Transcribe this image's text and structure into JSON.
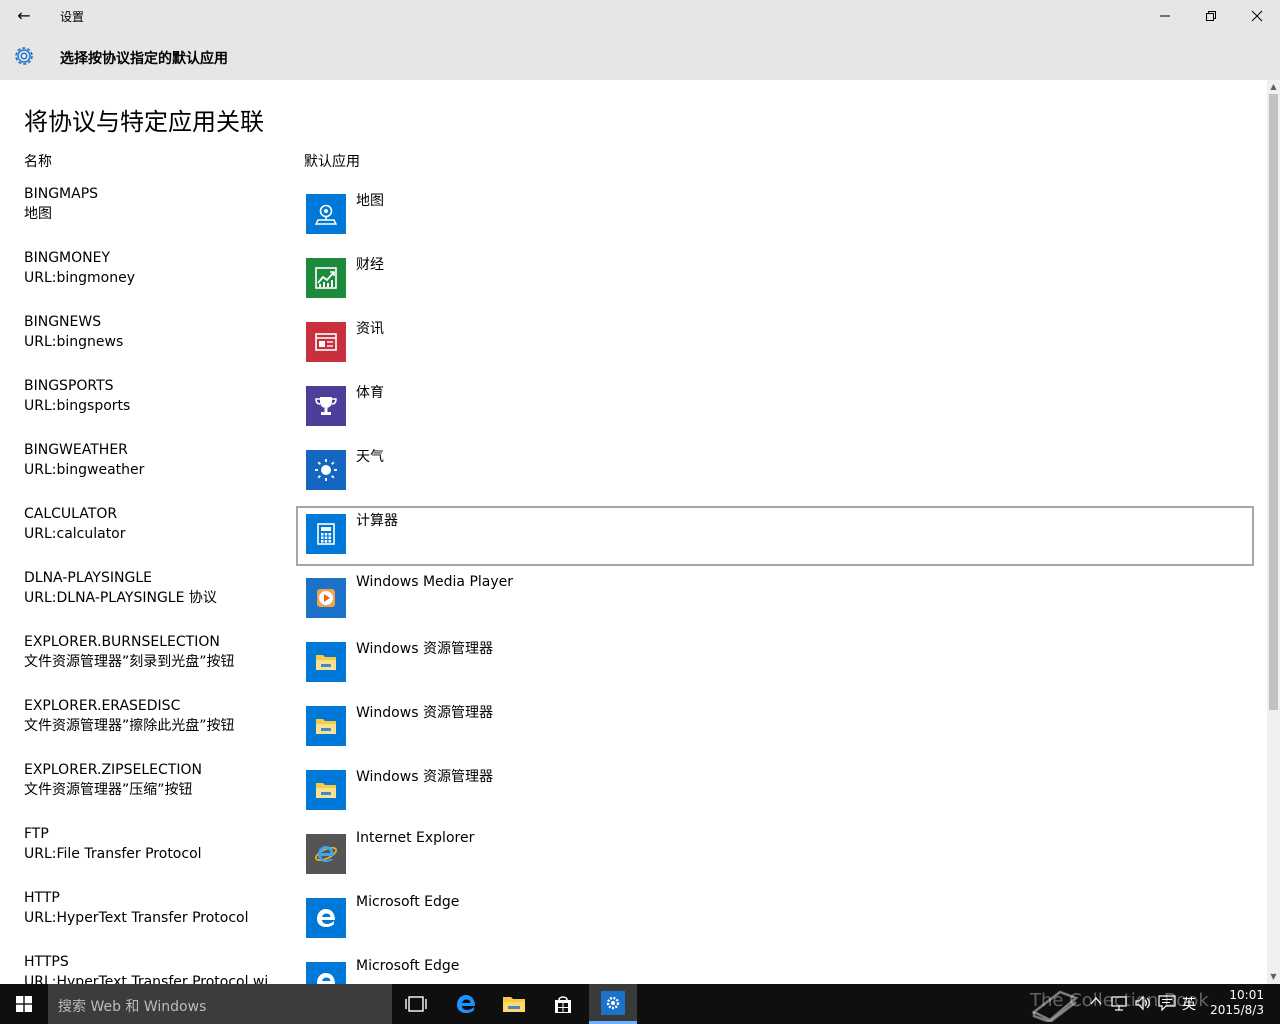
{
  "window": {
    "title": "设置",
    "back": "←"
  },
  "header": {
    "title": "选择按协议指定的默认应用"
  },
  "page": {
    "title": "将协议与特定应用关联",
    "col_name": "名称",
    "col_app": "默认应用"
  },
  "rows": [
    {
      "name": "BINGMAPS",
      "desc": "地图",
      "app": "地图",
      "icon": "maps-icon",
      "color": "#0078d7",
      "selected": false
    },
    {
      "name": "BINGMONEY",
      "desc": "URL:bingmoney",
      "app": "财经",
      "icon": "money-icon",
      "color": "#1e8a3c",
      "selected": false
    },
    {
      "name": "BINGNEWS",
      "desc": "URL:bingnews",
      "app": "资讯",
      "icon": "news-icon",
      "color": "#c8303d",
      "selected": false
    },
    {
      "name": "BINGSPORTS",
      "desc": "URL:bingsports",
      "app": "体育",
      "icon": "trophy-icon",
      "color": "#4b3f9a",
      "selected": false
    },
    {
      "name": "BINGWEATHER",
      "desc": "URL:bingweather",
      "app": "天气",
      "icon": "sun-icon",
      "color": "#1566c0",
      "selected": false
    },
    {
      "name": "CALCULATOR",
      "desc": "URL:calculator",
      "app": "计算器",
      "icon": "calculator-icon",
      "color": "#0078d7",
      "selected": true
    },
    {
      "name": "DLNA-PLAYSINGLE",
      "desc": "URL:DLNA-PLAYSINGLE 协议",
      "app": "Windows Media Player",
      "icon": "media-player-icon",
      "color": "#1a72c9",
      "selected": false
    },
    {
      "name": "EXPLORER.BURNSELECTION",
      "desc": "文件资源管理器”刻录到光盘”按钮",
      "app": "Windows 资源管理器",
      "icon": "folder-icon",
      "color": "#0078d7",
      "selected": false
    },
    {
      "name": "EXPLORER.ERASEDISC",
      "desc": "文件资源管理器”擦除此光盘”按钮",
      "app": "Windows 资源管理器",
      "icon": "folder-icon",
      "color": "#0078d7",
      "selected": false
    },
    {
      "name": "EXPLORER.ZIPSELECTION",
      "desc": "文件资源管理器”压缩”按钮",
      "app": "Windows 资源管理器",
      "icon": "folder-icon",
      "color": "#0078d7",
      "selected": false
    },
    {
      "name": "FTP",
      "desc": "URL:File Transfer Protocol",
      "app": "Internet Explorer",
      "icon": "ie-icon",
      "color": "#555555",
      "selected": false
    },
    {
      "name": "HTTP",
      "desc": "URL:HyperText Transfer Protocol",
      "app": "Microsoft Edge",
      "icon": "edge-icon",
      "color": "#0078d7",
      "selected": false
    },
    {
      "name": "HTTPS",
      "desc": "URL:HyperText Transfer Protocol wi",
      "app": "Microsoft Edge",
      "icon": "edge-icon",
      "color": "#0078d7",
      "selected": false
    }
  ],
  "taskbar": {
    "search_placeholder": "搜索 Web 和 Windows",
    "ime": "英",
    "time": "10:01",
    "date": "2015/8/3",
    "watermark": "The Collection Book"
  }
}
